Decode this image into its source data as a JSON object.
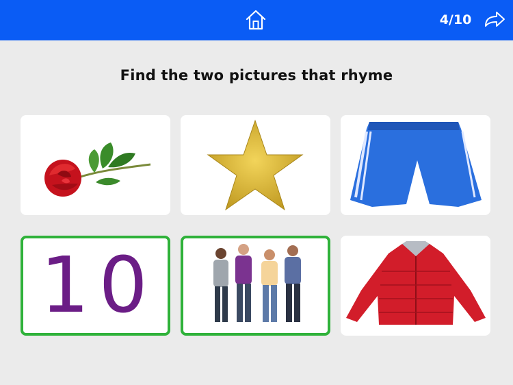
{
  "header": {
    "progress": "4/10",
    "home_icon": "home-icon",
    "next_icon": "forward-arrow-icon",
    "bar_color": "#0a5cf5"
  },
  "prompt": "Find the two pictures that rhyme",
  "cards": [
    {
      "picture": "rose",
      "selected": false
    },
    {
      "picture": "gold star",
      "selected": false
    },
    {
      "picture": "blue shorts",
      "selected": false
    },
    {
      "picture": "number 10",
      "text": "10",
      "selected": true
    },
    {
      "picture": "four men",
      "selected": true
    },
    {
      "picture": "red jacket",
      "selected": false
    }
  ],
  "selection_color": "#2fb23a"
}
